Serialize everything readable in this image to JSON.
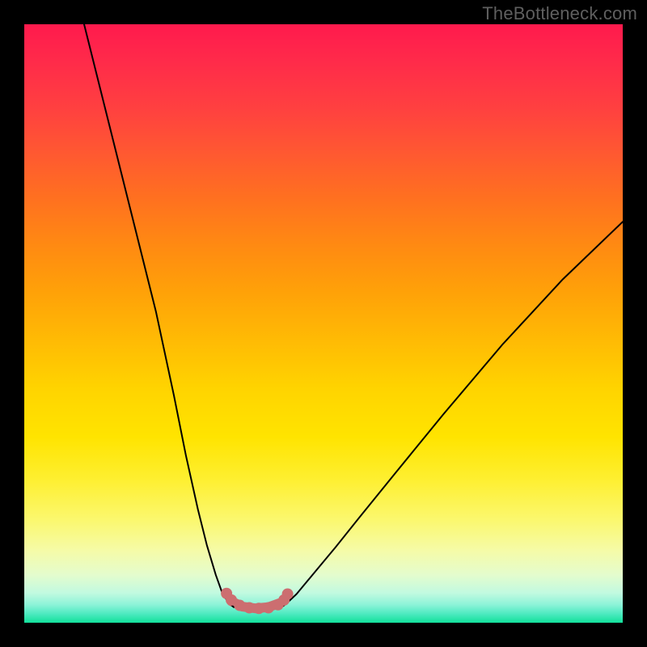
{
  "watermark": "TheBottleneck.com",
  "chart_data": {
    "type": "line",
    "title": "",
    "xlabel": "",
    "ylabel": "",
    "xlim": [
      0,
      100
    ],
    "ylim": [
      0,
      100
    ],
    "grid": false,
    "series": [
      {
        "name": "left-branch",
        "color": "#000000",
        "width": 2,
        "x": [
          10,
          14,
          18,
          22,
          25,
          27,
          29,
          30.5,
          32,
          33,
          34,
          35
        ],
        "y": [
          100,
          84,
          68,
          52,
          38,
          28,
          19,
          13,
          8,
          5.2,
          3.5,
          2.6
        ]
      },
      {
        "name": "right-branch",
        "color": "#000000",
        "width": 2,
        "x": [
          43,
          44,
          45.5,
          47,
          49,
          52,
          56,
          62,
          70,
          80,
          90,
          100
        ],
        "y": [
          2.6,
          3.4,
          4.8,
          6.6,
          9.0,
          12.6,
          17.6,
          25.0,
          34.8,
          46.6,
          57.4,
          67.0
        ]
      },
      {
        "name": "trough-markers",
        "color": "#cc6e70",
        "type": "scatter",
        "marker_size": 14,
        "x": [
          33.8,
          34.6,
          36.0,
          37.6,
          39.2,
          40.8,
          42.4,
          43.4,
          44.0
        ],
        "y": [
          4.9,
          3.8,
          2.9,
          2.5,
          2.4,
          2.5,
          3.0,
          3.8,
          4.8
        ]
      },
      {
        "name": "trough-connector",
        "color": "#cc6e70",
        "width": 12,
        "x": [
          34.6,
          36.4,
          38.6,
          40.8,
          43.0
        ],
        "y": [
          3.6,
          2.7,
          2.4,
          2.6,
          3.4
        ]
      }
    ],
    "notes": "Axes are unlabeled in the image; 0–100 domain/range chosen for convenience. Values estimated from pixel positions."
  }
}
